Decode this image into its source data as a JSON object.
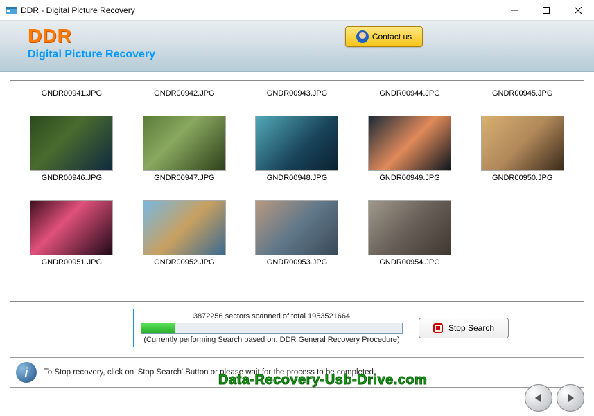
{
  "window": {
    "title": "DDR - Digital Picture Recovery"
  },
  "header": {
    "logo": "DDR",
    "subtitle": "Digital Picture Recovery",
    "contact_label": "Contact us"
  },
  "files": {
    "row_top": [
      "GNDR00941.JPG",
      "GNDR00942.JPG",
      "GNDR00943.JPG",
      "GNDR00944.JPG",
      "GNDR00945.JPG"
    ],
    "row_mid": [
      "GNDR00946.JPG",
      "GNDR00947.JPG",
      "GNDR00948.JPG",
      "GNDR00949.JPG",
      "GNDR00950.JPG"
    ],
    "row_bot": [
      "GNDR00951.JPG",
      "GNDR00952.JPG",
      "GNDR00953.JPG",
      "GNDR00954.JPG"
    ]
  },
  "progress": {
    "scanned": "3872256",
    "total": "1953521664",
    "line1": "3872256 sectors scanned of total 1953521664",
    "line2": "(Currently performing Search based on:  DDR General Recovery Procedure)",
    "stop_label": "Stop Search"
  },
  "footer": {
    "hint": "To Stop recovery, click on 'Stop Search' Button or please wait for the process to be completed.",
    "watermark": "Data-Recovery-Usb-Drive.com"
  }
}
